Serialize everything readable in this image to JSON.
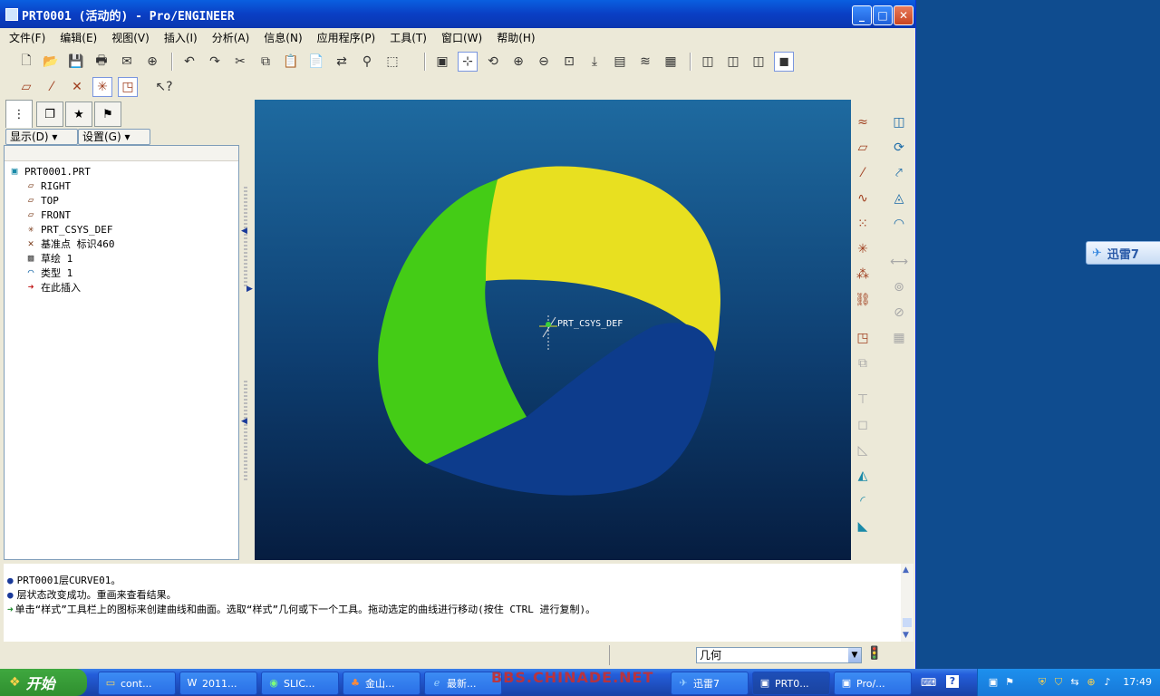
{
  "window": {
    "title": "PRT0001 (活动的) - Pro/ENGINEER",
    "minimize": "_",
    "maximize": "□",
    "close": "✕"
  },
  "menu": [
    "文件(F)",
    "编辑(E)",
    "视图(V)",
    "插入(I)",
    "分析(A)",
    "信息(N)",
    "应用程序(P)",
    "工具(T)",
    "窗口(W)",
    "帮助(H)"
  ],
  "panel": {
    "display_label": "显示(D) ▾",
    "settings_label": "设置(G) ▾",
    "tree": [
      {
        "label": "PRT0001.PRT",
        "icon": "part-icon"
      },
      {
        "label": "RIGHT",
        "icon": "datum-plane-icon"
      },
      {
        "label": "TOP",
        "icon": "datum-plane-icon"
      },
      {
        "label": "FRONT",
        "icon": "datum-plane-icon"
      },
      {
        "label": "PRT_CSYS_DEF",
        "icon": "csys-icon"
      },
      {
        "label": "基准点 标识460",
        "icon": "datum-point-icon"
      },
      {
        "label": "草绘 1",
        "icon": "sketch-icon"
      },
      {
        "label": "类型 1",
        "icon": "style-icon"
      },
      {
        "label": "在此插入",
        "icon": "insert-arrow-icon"
      }
    ]
  },
  "viewport": {
    "csys_label": "PRT_CSYS_DEF",
    "colors": {
      "yellow": "#e8e020",
      "green": "#44cc16",
      "blue": "#0d3c8c"
    }
  },
  "messages": [
    {
      "bullet": "●",
      "text": "PRT0001层CURVE01。"
    },
    {
      "bullet": "●",
      "text": "层状态改变成功。重画来查看结果。"
    },
    {
      "bullet": "➜",
      "text": "单击“样式”工具栏上的图标来创建曲线和曲面。选取“样式”几何或下一个工具。拖动选定的曲线进行移动(按住 CTRL 进行复制)。"
    }
  ],
  "status": {
    "filter_value": "几何"
  },
  "xunlei": {
    "label": "迅雷7"
  },
  "taskbar": {
    "start": "开始",
    "tasks": [
      {
        "label": "cont...",
        "icon": "folder-icon"
      },
      {
        "label": "2011...",
        "icon": "word-icon"
      },
      {
        "label": "SLIC...",
        "icon": "chrome-icon"
      },
      {
        "label": "金山...",
        "icon": "kingsoft-icon"
      },
      {
        "label": "最新...",
        "icon": "ie-icon"
      },
      {
        "label": "迅雷7",
        "icon": "xunlei-icon"
      },
      {
        "label": "PRT0...",
        "icon": "proe-icon"
      },
      {
        "label": "Pro/...",
        "icon": "proe-icon"
      }
    ],
    "clock": "17:49",
    "watermark": "BBS.CHINADE.NET"
  }
}
